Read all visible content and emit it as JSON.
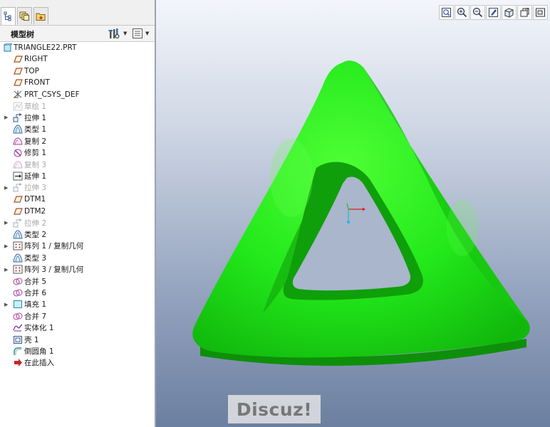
{
  "panel": {
    "title": "模型树",
    "tabs": [
      {
        "name": "model-tree-tab-icon",
        "active": true
      },
      {
        "name": "layers-tab-icon",
        "active": false
      },
      {
        "name": "favorites-tab-icon",
        "active": false
      }
    ]
  },
  "tree": {
    "items": [
      {
        "label": "TRIANGLE22.PRT",
        "icon": "part-icon",
        "indent": 0,
        "expandable": false,
        "dim": false
      },
      {
        "label": "RIGHT",
        "icon": "datum-plane-icon",
        "indent": 1,
        "expandable": false,
        "dim": false
      },
      {
        "label": "TOP",
        "icon": "datum-plane-icon",
        "indent": 1,
        "expandable": false,
        "dim": false
      },
      {
        "label": "FRONT",
        "icon": "datum-plane-icon",
        "indent": 1,
        "expandable": false,
        "dim": false
      },
      {
        "label": "PRT_CSYS_DEF",
        "icon": "csys-icon",
        "indent": 1,
        "expandable": false,
        "dim": false
      },
      {
        "label": "草绘 1",
        "icon": "sketch-icon",
        "indent": 1,
        "expandable": false,
        "dim": true
      },
      {
        "label": "拉伸 1",
        "icon": "extrude-icon",
        "indent": 1,
        "expandable": true,
        "dim": false
      },
      {
        "label": "类型 1",
        "icon": "surface-icon",
        "indent": 1,
        "expandable": false,
        "dim": false
      },
      {
        "label": "复制 2",
        "icon": "copy-icon",
        "indent": 1,
        "expandable": false,
        "dim": false
      },
      {
        "label": "修剪 1",
        "icon": "trim-icon",
        "indent": 1,
        "expandable": false,
        "dim": false
      },
      {
        "label": "复制 3",
        "icon": "copy-icon",
        "indent": 1,
        "expandable": false,
        "dim": true
      },
      {
        "label": "延伸 1",
        "icon": "extend-icon",
        "indent": 1,
        "expandable": false,
        "dim": false
      },
      {
        "label": "拉伸 3",
        "icon": "extrude-icon",
        "indent": 1,
        "expandable": true,
        "dim": true
      },
      {
        "label": "DTM1",
        "icon": "datum-plane-icon",
        "indent": 1,
        "expandable": false,
        "dim": false
      },
      {
        "label": "DTM2",
        "icon": "datum-plane-icon",
        "indent": 1,
        "expandable": false,
        "dim": false
      },
      {
        "label": "拉伸 2",
        "icon": "extrude-icon",
        "indent": 1,
        "expandable": true,
        "dim": true
      },
      {
        "label": "类型 2",
        "icon": "surface-icon",
        "indent": 1,
        "expandable": false,
        "dim": false
      },
      {
        "label": "阵列 1 / 复制几何",
        "icon": "pattern-icon",
        "indent": 1,
        "expandable": true,
        "dim": false
      },
      {
        "label": "类型 3",
        "icon": "surface-icon",
        "indent": 1,
        "expandable": false,
        "dim": false
      },
      {
        "label": "阵列 3 / 复制几何",
        "icon": "pattern-icon",
        "indent": 1,
        "expandable": true,
        "dim": false
      },
      {
        "label": "合并 5",
        "icon": "merge-icon",
        "indent": 1,
        "expandable": false,
        "dim": false
      },
      {
        "label": "合并 6",
        "icon": "merge-icon",
        "indent": 1,
        "expandable": false,
        "dim": false
      },
      {
        "label": "填充 1",
        "icon": "fill-icon",
        "indent": 1,
        "expandable": true,
        "dim": false
      },
      {
        "label": "合并 7",
        "icon": "merge-icon",
        "indent": 1,
        "expandable": false,
        "dim": false
      },
      {
        "label": "实体化 1",
        "icon": "solidify-icon",
        "indent": 1,
        "expandable": false,
        "dim": false
      },
      {
        "label": "壳 1",
        "icon": "shell-icon",
        "indent": 1,
        "expandable": false,
        "dim": false
      },
      {
        "label": "倒圆角 1",
        "icon": "round-icon",
        "indent": 1,
        "expandable": false,
        "dim": false
      },
      {
        "label": "在此插入",
        "icon": "insert-here-icon",
        "indent": 1,
        "expandable": false,
        "dim": false
      }
    ]
  },
  "viewport": {
    "toolbar": [
      "refit-icon",
      "zoom-in-icon",
      "zoom-out-icon",
      "repaint-icon",
      "display-style-icon",
      "saved-views-icon",
      "view-manager-icon"
    ],
    "model_color": "#22e81a",
    "watermark": "Discuz!"
  }
}
